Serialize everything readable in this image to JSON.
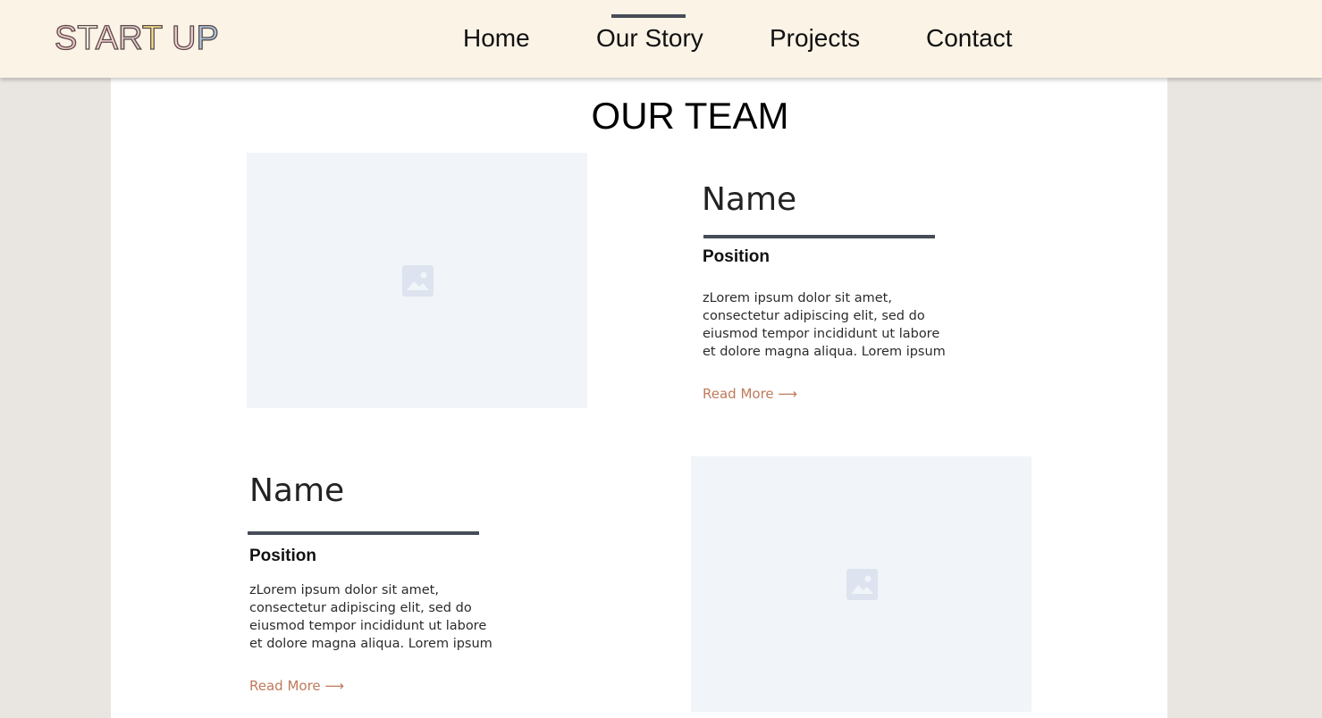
{
  "header": {
    "logo_letters": [
      {
        "char": "S",
        "fill": "#f1c7c7"
      },
      {
        "char": "T",
        "fill": "#fbf3e6"
      },
      {
        "char": "A",
        "fill": "#f6d2d2"
      },
      {
        "char": "R",
        "fill": "#d9c6c6"
      },
      {
        "char": "T",
        "fill": "#f7e48a"
      },
      {
        "char": " ",
        "fill": "#fbf3e6"
      },
      {
        "char": "U",
        "fill": "#f4d1d1"
      },
      {
        "char": "P",
        "fill": "#a9c7de"
      }
    ],
    "nav": [
      {
        "label": "Home",
        "active": false
      },
      {
        "label": "Our Story",
        "active": true
      },
      {
        "label": "Projects",
        "active": false
      },
      {
        "label": "Contact",
        "active": false
      }
    ]
  },
  "main": {
    "title": "OUR TEAM",
    "members": [
      {
        "name": "Name",
        "position": "Position",
        "bio": "zLorem ipsum dolor sit amet, consectetur adipiscing elit, sed do eiusmod tempor incididunt ut labore et dolore magna aliqua. Lorem ipsum",
        "read_more": "Read More ⟶",
        "photo_icon": "image-placeholder-icon"
      },
      {
        "name": "Name",
        "position": "Position",
        "bio": "zLorem ipsum dolor sit amet, consectetur adipiscing elit, sed do eiusmod tempor incididunt ut labore et dolore magna aliqua. Lorem ipsum",
        "read_more": "Read More ⟶",
        "photo_icon": "image-placeholder-icon"
      }
    ]
  },
  "colors": {
    "header_bg": "#fbf3e6",
    "accent_bar": "#474d57",
    "link": "#c07a5c",
    "photo_bg": "#f1f5f9",
    "icon": "#dde3ef"
  }
}
